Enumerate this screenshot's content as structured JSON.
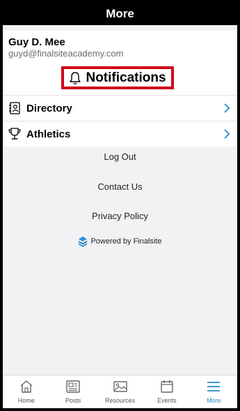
{
  "header": {
    "title": "More"
  },
  "profile": {
    "name": "Guy D. Mee",
    "email": "guyd@finalsiteacademy.com"
  },
  "notifications": {
    "label": "Notifications"
  },
  "menu": {
    "items": [
      {
        "label": "Directory",
        "icon": "directory-icon"
      },
      {
        "label": "Athletics",
        "icon": "trophy-icon"
      }
    ]
  },
  "links": {
    "logout": "Log Out",
    "contact": "Contact Us",
    "privacy": "Privacy Policy"
  },
  "powered": {
    "label": "Powered by Finalsite"
  },
  "tabs": [
    {
      "label": "Home",
      "icon": "home-icon"
    },
    {
      "label": "Posts",
      "icon": "posts-icon"
    },
    {
      "label": "Resources",
      "icon": "resources-icon"
    },
    {
      "label": "Events",
      "icon": "calendar-icon"
    },
    {
      "label": "More",
      "icon": "menu-icon",
      "active": true
    }
  ],
  "colors": {
    "accent": "#1f8bd0",
    "highlight": "#d0021b",
    "header": "#000000"
  }
}
